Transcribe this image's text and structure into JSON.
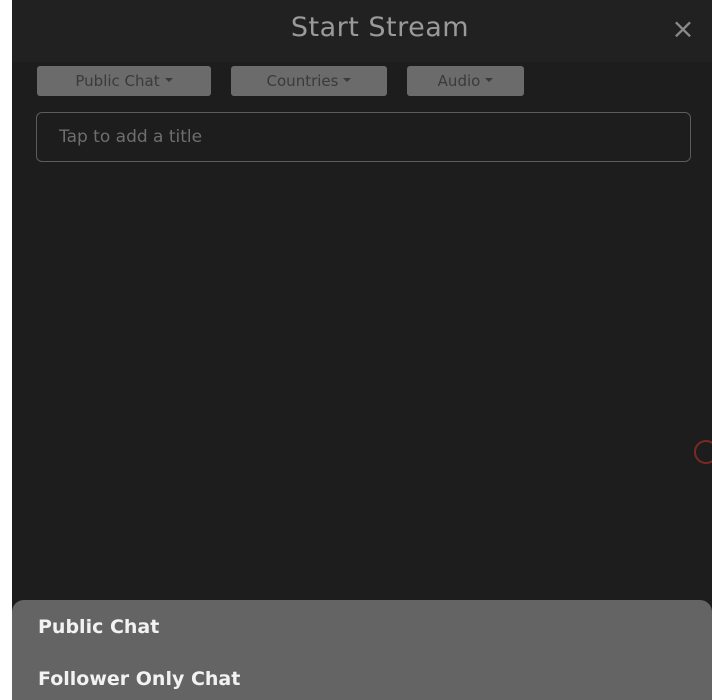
{
  "header": {
    "title": "Start Stream",
    "close_icon": "×"
  },
  "filters": {
    "chat": "Public Chat",
    "countries": "Countries",
    "audio": "Audio"
  },
  "title_field": {
    "placeholder": "Tap to add a title",
    "value": ""
  },
  "chat_menu": {
    "options": [
      "Public Chat",
      "Follower Only Chat"
    ]
  }
}
